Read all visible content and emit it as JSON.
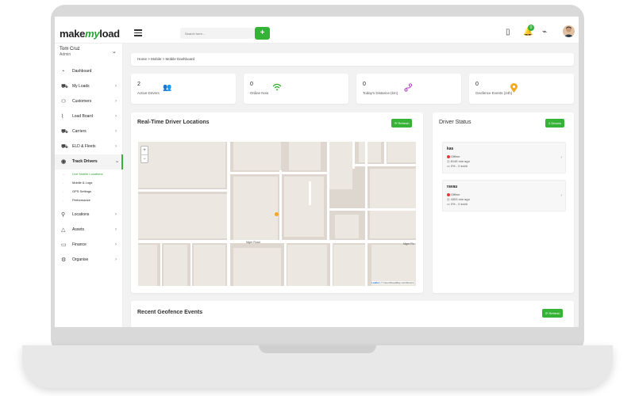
{
  "topbar": {
    "logo_a": "make",
    "logo_b": "my",
    "logo_c": "load",
    "search_placeholder": "Search here...",
    "add_label": "+",
    "notif_count": "0"
  },
  "user": {
    "name": "Tom Cruz",
    "role": "Admin"
  },
  "sidebar": {
    "items": [
      {
        "label": "Dashboard",
        "icon": "dashboard-icon"
      },
      {
        "label": "My Loads",
        "icon": "truck-icon"
      },
      {
        "label": "Customers",
        "icon": "users-icon"
      },
      {
        "label": "Load Board",
        "icon": "chart-icon"
      },
      {
        "label": "Carriers",
        "icon": "truck-icon"
      },
      {
        "label": "ELD & Fleets",
        "icon": "truck-icon"
      },
      {
        "label": "Track Drivers",
        "icon": "location-icon"
      },
      {
        "label": "Locations",
        "icon": "pin-icon"
      },
      {
        "label": "Assets",
        "icon": "assets-icon"
      },
      {
        "label": "Finance",
        "icon": "finance-icon"
      },
      {
        "label": "Organise",
        "icon": "gear-icon"
      }
    ],
    "subitems": [
      "Live Mobile Locations",
      "Mobile & Logs",
      "GPS Settings",
      "Performance"
    ]
  },
  "breadcrumb": "Home > Mobile > Mobile Dashboard",
  "stats": [
    {
      "value": "2",
      "label": "Active Drivers"
    },
    {
      "value": "0",
      "label": "Online Now"
    },
    {
      "value": "0",
      "label": "Today's Distance (km)"
    },
    {
      "value": "0",
      "label": "Geofence Events (24h)"
    }
  ],
  "map_card": {
    "title": "Real-Time Driver Locations",
    "refresh": "⟳ Refresh",
    "zoom_in": "+",
    "zoom_out": "−",
    "road_label_1": "Niger Road",
    "road_label_2": "Niger Ro",
    "attrib_leaflet": "Leaflet",
    "attrib_rest": " | © OpenStreetMap contributors"
  },
  "status_card": {
    "title": "Driver Status",
    "badge": "2 Drivers",
    "drivers": [
      {
        "name": "kas",
        "status": "Offline",
        "ago": "8145 min ago",
        "meta": "0% - 0 km/h"
      },
      {
        "name": "ravau",
        "status": "Offline",
        "ago": "4303 min ago",
        "meta": "0% - 0 km/h"
      }
    ]
  },
  "geofence_card": {
    "title": "Recent Geofence Events",
    "refresh": "⟳ Refresh"
  },
  "colors": {
    "accent": "#35b336",
    "offline": "#e53935",
    "marker": "#f5a623"
  }
}
